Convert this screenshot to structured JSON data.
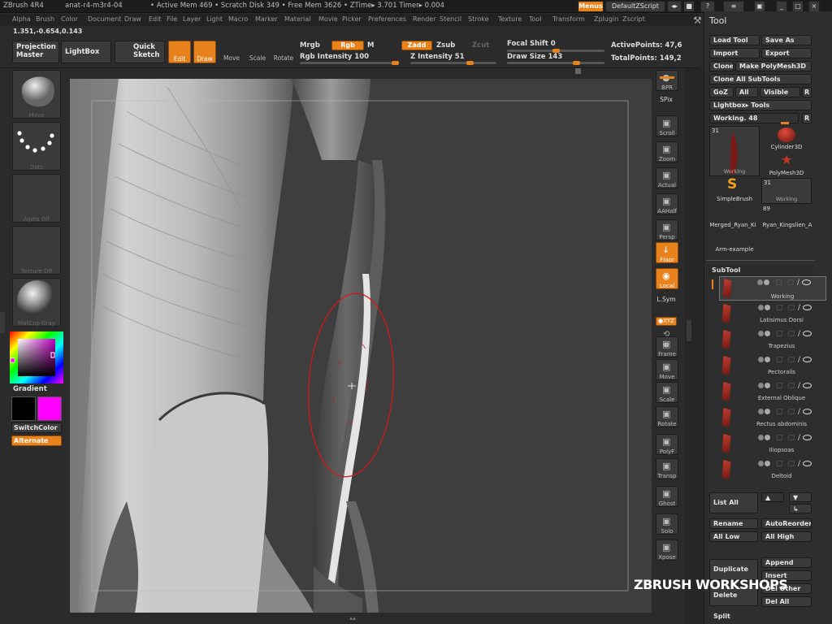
{
  "titlebar": {
    "app": "ZBrush 4R4",
    "doc": "anat-r4-m3r4-04",
    "stats": "• Active Mem 469 • Scratch Disk 349 • Free Mem 3626 • ZTime▸ 3.701 Timer▸ 0.004",
    "menus": "Menus",
    "zscript": "DefaultZScript"
  },
  "menubar": [
    "Alpha",
    "Brush",
    "Color",
    "Document",
    "Draw",
    "Edit",
    "File",
    "Layer",
    "Light",
    "Macro",
    "Marker",
    "Material",
    "Movie",
    "Picker",
    "Preferences",
    "Render",
    "Stencil",
    "Stroke",
    "Texture",
    "Tool",
    "Transform",
    "Zplugin",
    "Zscript"
  ],
  "toolbar": {
    "coords": "1.351,-0.654,0.143",
    "projection_master": "Projection Master",
    "lightbox": "LightBox",
    "quick_sketch": "Quick Sketch",
    "edit": "Edit",
    "draw": "Draw",
    "move": "Move",
    "scale": "Scale",
    "rotate": "Rotate",
    "mrgb": "Mrgb",
    "rgb": "Rgb",
    "m": "M",
    "zadd": "Zadd",
    "zsub": "Zsub",
    "zcut": "Zcut",
    "rgb_intensity": "Rgb Intensity 100",
    "z_intensity": "Z Intensity 51",
    "focal_shift": "Focal Shift 0",
    "draw_size": "Draw Size 143",
    "active_points": "ActivePoints: 47,6",
    "total_points": "TotalPoints: 149,2"
  },
  "leftshelf": {
    "move": "Move",
    "dots": "Dots",
    "alpha_off": "Alpha Off",
    "texture_off": "Texture Off",
    "matcap": "MatCap Gray",
    "gradient": "Gradient",
    "switch_color": "SwitchColor",
    "alternate": "Alternate"
  },
  "rightshelf": [
    "BPR",
    "SPix",
    "Scroll",
    "Zoom",
    "Actual",
    "AAHalf",
    "Persp",
    "Floor",
    "Local",
    "L.Sym",
    "●XYZ",
    "Frame",
    "Move",
    "Scale",
    "Rotate",
    "PolyF",
    "Transp",
    "Ghost",
    "Solo",
    "Xpose"
  ],
  "tool": {
    "title": "Tool",
    "load_tool": "Load Tool",
    "save_as": "Save As",
    "import": "Import",
    "export": "Export",
    "clone": "Clone",
    "make_polymesh": "Make PolyMesh3D",
    "clone_all": "Clone  All SubTools",
    "goz": "GoZ",
    "all": "All",
    "visible": "Visible",
    "r": "R",
    "lightbox_tools": "Lightbox▸ Tools",
    "working": "Working. 48",
    "thumbs": [
      {
        "label": "Working",
        "count": "31"
      },
      {
        "label": "Cylinder3D",
        "count": ""
      },
      {
        "label": "PolyMesh3D",
        "count": ""
      },
      {
        "label": "SimpleBrush",
        "count": ""
      },
      {
        "label": "Working",
        "count": "31"
      },
      {
        "label": "Merged_Ryan_Ki",
        "count": ""
      },
      {
        "label": "Ryan_Kingslien_A",
        "count": "89"
      },
      {
        "label": "Arm-example",
        "count": ""
      }
    ],
    "subtool_header": "SubTool",
    "subtools": [
      "Working",
      "Latisimus  Dorsi",
      "Trapezius",
      "Pectoralis",
      "External  Oblique",
      "Rectus  abdominis",
      "Iliopsoas",
      "Deltoid"
    ],
    "list_all": "List All",
    "rename": "Rename",
    "auto_reorder": "AutoReorder",
    "all_low": "All Low",
    "all_high": "All High",
    "duplicate": "Duplicate",
    "append": "Append",
    "insert": "Insert",
    "delete": "Delete",
    "del_other": "Del Other",
    "del_all": "Del All",
    "split": "Split"
  },
  "watermark": "ZBRUSH WORKSHOPS",
  "colors": {
    "accent": "#e8821c",
    "secondary_color": "#ff00ff",
    "main_color": "#000000"
  }
}
